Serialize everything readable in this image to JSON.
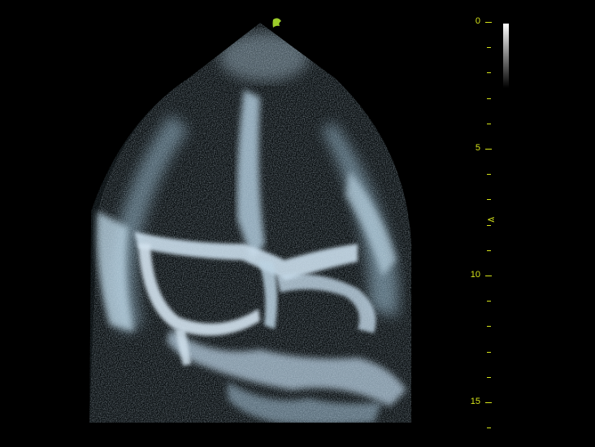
{
  "colors": {
    "scale": "#d6e41a",
    "tissue": "#b8d4e8",
    "background": "#000000",
    "orientation_marker": "#9ccc2a"
  },
  "icons": {
    "orientation_marker": "orientation-marker-icon",
    "focus_marker": "focus-marker-icon"
  },
  "depth_scale": {
    "unit": "cm",
    "min": 0,
    "max": 15,
    "labels": [
      "0",
      "5",
      "10",
      "15"
    ],
    "focus_depth": 7.8,
    "focus_glyph": "⋖"
  }
}
